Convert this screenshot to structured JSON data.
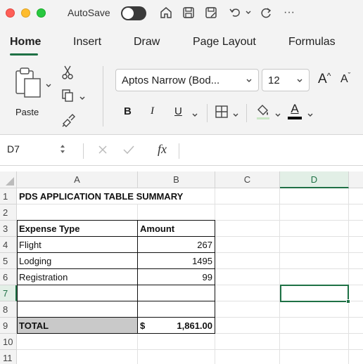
{
  "titlebar": {
    "autosave_label": "AutoSave",
    "autosave_on": false,
    "more_label": "···"
  },
  "tabs": [
    {
      "label": "Home",
      "active": true
    },
    {
      "label": "Insert",
      "active": false
    },
    {
      "label": "Draw",
      "active": false
    },
    {
      "label": "Page Layout",
      "active": false
    },
    {
      "label": "Formulas",
      "active": false
    }
  ],
  "ribbon": {
    "paste_label": "Paste",
    "font_name": "Aptos Narrow (Bod...",
    "font_size": "12",
    "bold_label": "B",
    "italic_label": "I",
    "underline_label": "U",
    "font_color_label": "A",
    "grow_font_label": "A",
    "shrink_font_label": "A"
  },
  "formula_bar": {
    "cell_ref": "D7",
    "fx_label": "fx",
    "value": ""
  },
  "sheet": {
    "columns": [
      "A",
      "B",
      "C",
      "D"
    ],
    "selected_column": "D",
    "selected_row": "7",
    "rows": [
      {
        "num": "1",
        "a": "PDS APPLICATION TABLE SUMMARY",
        "b": ""
      },
      {
        "num": "2",
        "a": "",
        "b": ""
      },
      {
        "num": "3",
        "a": "Expense Type",
        "b": "Amount"
      },
      {
        "num": "4",
        "a": "Flight",
        "b": "267"
      },
      {
        "num": "5",
        "a": "Lodging",
        "b": "1495"
      },
      {
        "num": "6",
        "a": "Registration",
        "b": "99"
      },
      {
        "num": "7",
        "a": "",
        "b": ""
      },
      {
        "num": "8",
        "a": "",
        "b": ""
      },
      {
        "num": "9",
        "a": "TOTAL",
        "b_currency": "$",
        "b": "1,861.00"
      },
      {
        "num": "10",
        "a": "",
        "b": ""
      },
      {
        "num": "11",
        "a": "",
        "b": ""
      }
    ]
  },
  "colors": {
    "accent": "#1e7145",
    "total_fill": "#c9c9c9"
  }
}
